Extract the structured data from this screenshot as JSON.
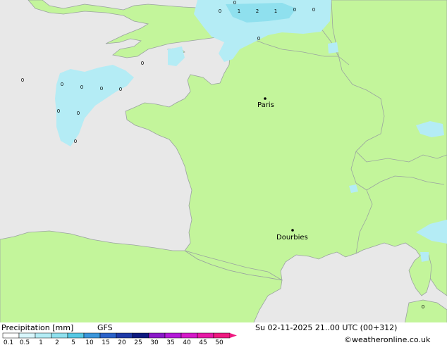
{
  "colors": {
    "sea": "#e8e8e8",
    "land": "#c3f59b",
    "border": "#9aa3a0",
    "precip_light": "#b4ecf5",
    "precip_mid": "#8fe0ee"
  },
  "precip_marks": [
    "0",
    "1",
    "2",
    "1",
    "0",
    "0",
    "0",
    "0",
    "0",
    "0",
    "0",
    "0",
    "0",
    "0",
    "0",
    "0",
    "0",
    "0"
  ],
  "cities": [
    {
      "name": "Paris"
    },
    {
      "name": "Dourbies"
    }
  ],
  "legend": {
    "title": "Precipitation [mm]",
    "model": "GFS",
    "scale_labels": [
      "0.1",
      "0.5",
      "1",
      "2",
      "5",
      "10",
      "15",
      "20",
      "25",
      "30",
      "35",
      "40",
      "45",
      "50"
    ],
    "scale_colors": [
      "#ffffff",
      "#d8f6fb",
      "#b4ecf5",
      "#8fe0ee",
      "#56c8e4",
      "#3b96db",
      "#2b62c9",
      "#1f3aa8",
      "#0e1a80",
      "#8a1ac8",
      "#b31ad8",
      "#d41ac8",
      "#e61aa6",
      "#ee1a80"
    ]
  },
  "valid_time": "Su 02-11-2025 21..00 UTC (00+312)",
  "credit": "©weatheronline.co.uk"
}
